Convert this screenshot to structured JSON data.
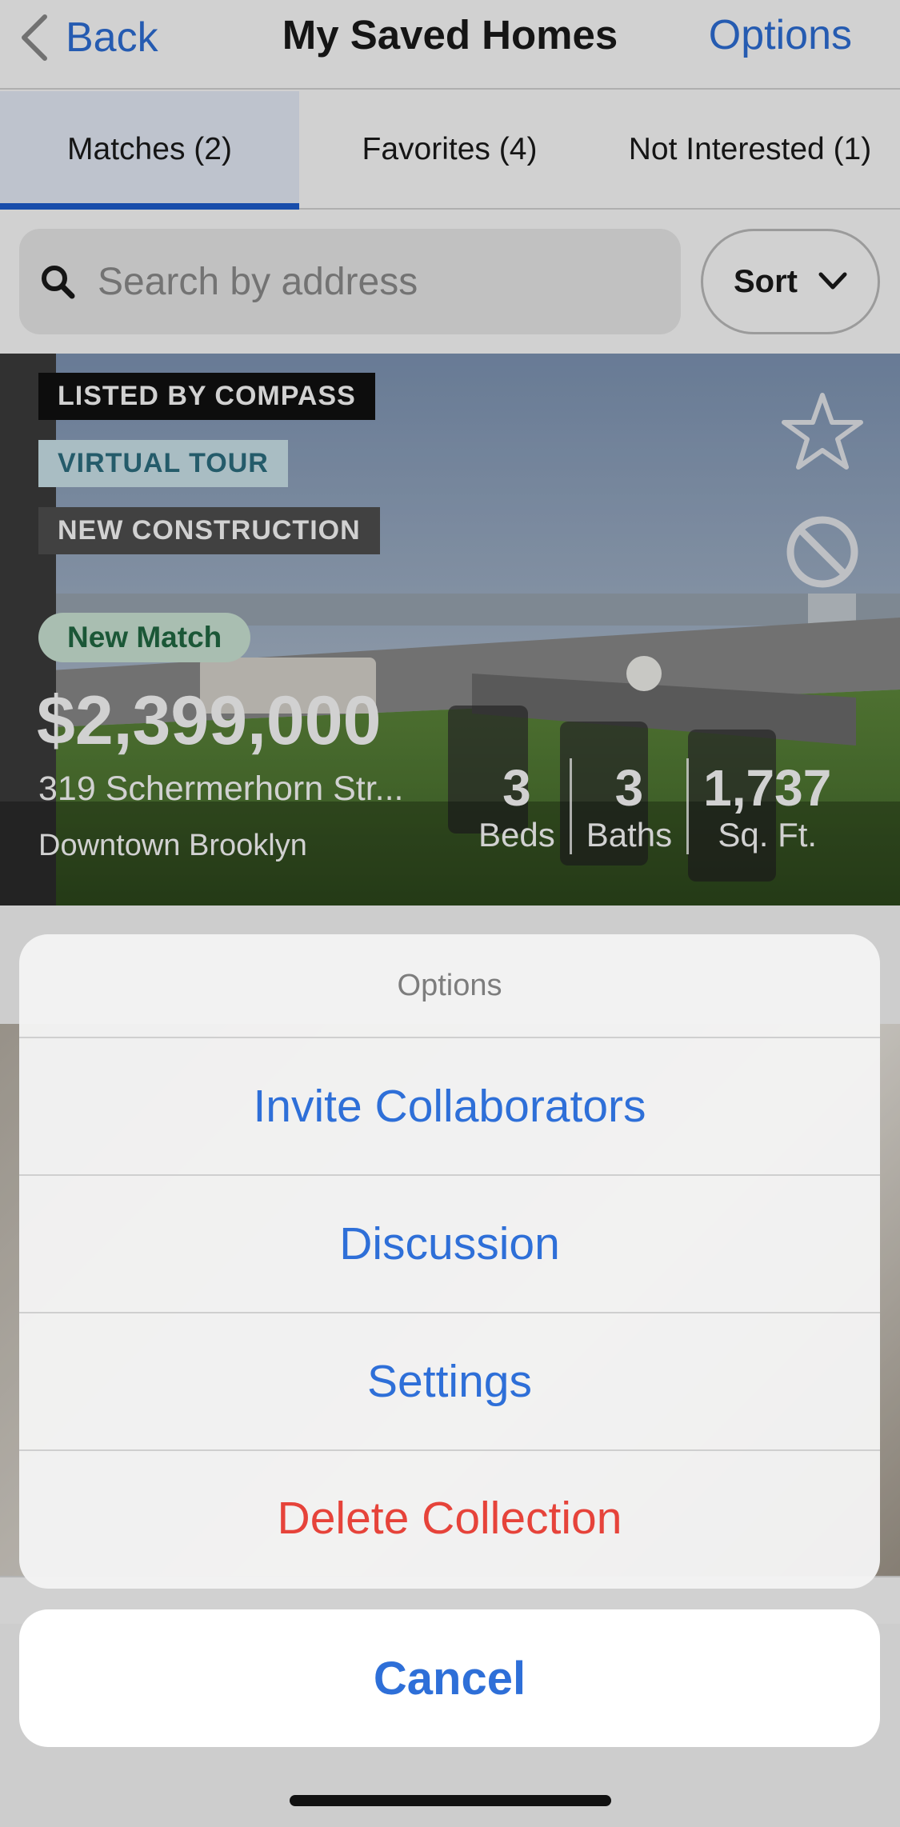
{
  "navbar": {
    "back_label": "Back",
    "title": "My Saved Homes",
    "options_label": "Options"
  },
  "tabs": [
    {
      "label": "Matches (2)",
      "selected": true
    },
    {
      "label": "Favorites (4)",
      "selected": false
    },
    {
      "label": "Not Interested (1)",
      "selected": false
    }
  ],
  "search": {
    "placeholder": "Search by address",
    "value": ""
  },
  "sort": {
    "label": "Sort"
  },
  "listing": {
    "badges": [
      "LISTED BY COMPASS",
      "VIRTUAL TOUR",
      "NEW CONSTRUCTION"
    ],
    "status_pill": "New Match",
    "price": "$2,399,000",
    "address": "319 Schermerhorn Str...",
    "neighborhood": "Downtown Brooklyn",
    "stats": [
      {
        "value": "3",
        "label": "Beds"
      },
      {
        "value": "3",
        "label": "Baths"
      },
      {
        "value": "1,737",
        "label": "Sq. Ft."
      }
    ]
  },
  "action_sheet": {
    "title": "Options",
    "items": [
      {
        "label": "Invite Collaborators"
      },
      {
        "label": "Discussion"
      },
      {
        "label": "Settings"
      },
      {
        "label": "Delete Collection"
      }
    ],
    "cancel_label": "Cancel"
  },
  "colors": {
    "accent": "#2e6fd8",
    "destructive": "#e6433a",
    "tab_indicator": "#1e5fd1"
  },
  "icons": {
    "back": "chevron-left-icon",
    "search": "magnifier-icon",
    "sort": "chevron-down-icon",
    "favorite": "star-outline-icon",
    "not_interested": "ban-icon"
  }
}
